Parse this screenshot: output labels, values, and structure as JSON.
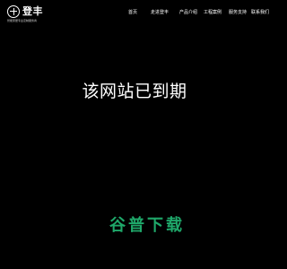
{
  "brand": {
    "name": "登丰",
    "tagline": "智能家居专业定制服务商"
  },
  "nav": {
    "items": [
      {
        "label": "首页"
      },
      {
        "label": "走进登丰"
      },
      {
        "label": "产品介绍"
      },
      {
        "label": "工程案例"
      },
      {
        "label": "服务支持"
      },
      {
        "label": "联系我们"
      }
    ]
  },
  "main": {
    "message": "该网站已到期"
  },
  "watermark": {
    "text": "谷普下载"
  },
  "colors": {
    "background": "#000000",
    "text": "#ffffff",
    "watermark": "#1fa86a"
  }
}
